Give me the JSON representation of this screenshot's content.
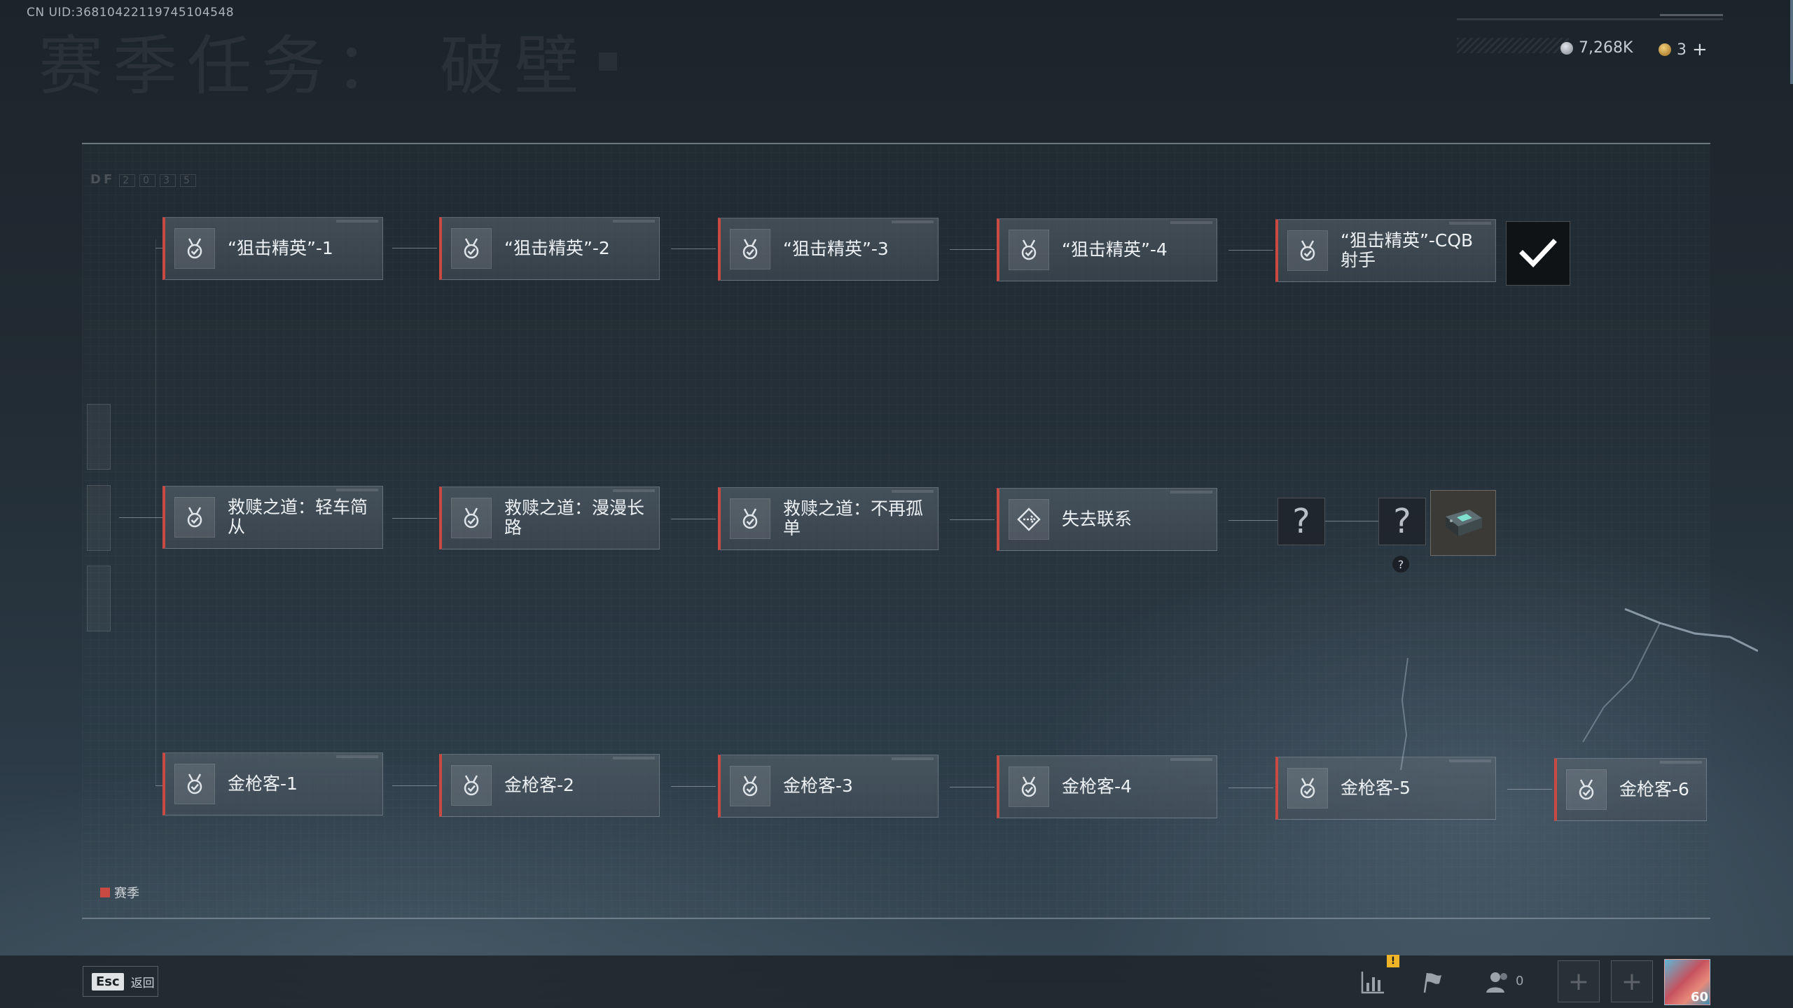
{
  "header": {
    "uid": "CN UID:3681042211974510454​8",
    "background_title": "赛季任务： 破壁",
    "currency_silver": "7,268K",
    "currency_gold": "3"
  },
  "panel": {
    "tag": "DF",
    "tag_numbers": [
      "2",
      "0",
      "3",
      "5"
    ]
  },
  "rows": {
    "row1": [
      {
        "label": "“狙击精英”-1"
      },
      {
        "label": "“狙击精英”-2"
      },
      {
        "label": "“狙击精英”-3"
      },
      {
        "label": "“狙击精英”-4"
      },
      {
        "label": "“狙击精英”-CQB射手"
      }
    ],
    "row2": [
      {
        "label": "救赎之道：轻车简从"
      },
      {
        "label": "救赎之道：漫漫长路"
      },
      {
        "label": "救赎之道：不再孤单"
      },
      {
        "label": "失去联系"
      }
    ],
    "row3": [
      {
        "label": "金枪客-1"
      },
      {
        "label": "金枪客-2"
      },
      {
        "label": "金枪客-3"
      },
      {
        "label": "金枪客-4"
      },
      {
        "label": "金枪客-5"
      },
      {
        "label": "金枪客-6"
      }
    ]
  },
  "unknown": {
    "q1": "?",
    "q2": "?",
    "hint": "?"
  },
  "legend": {
    "label": "赛季",
    "color": "#c94a43"
  },
  "footer": {
    "esc_key": "Esc",
    "esc_label": "返回",
    "friends_count": "0",
    "alert_badge": "!",
    "avatar_level": "60"
  },
  "icons": {
    "task": "medal-check-icon",
    "lost_contact": "diamond-route-icon",
    "reward_done": "checkmark-icon",
    "item": "device-icon",
    "stats": "bar-chart-icon",
    "flag": "flag-icon",
    "friends": "friends-icon"
  }
}
